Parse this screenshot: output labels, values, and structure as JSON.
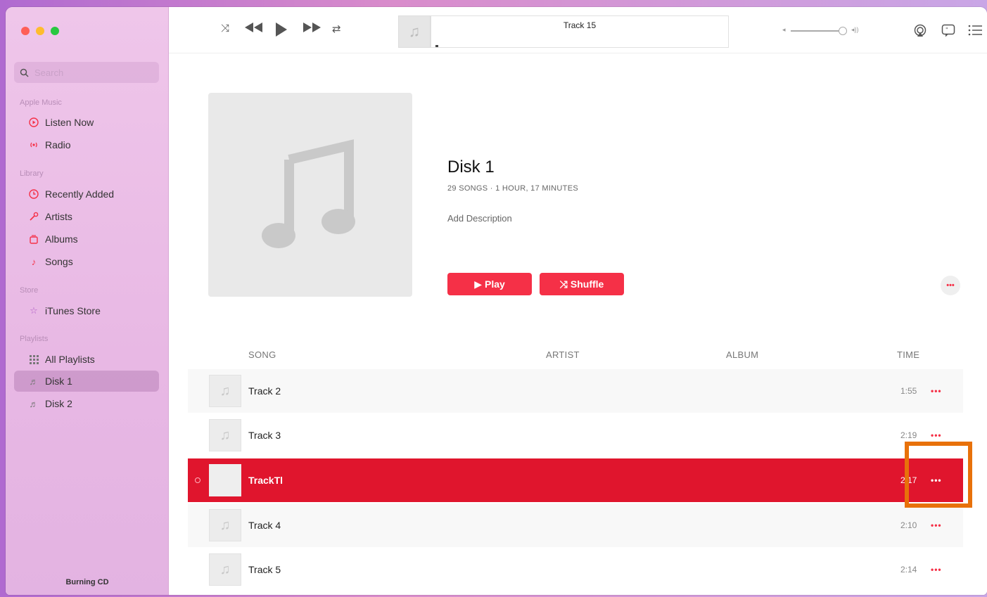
{
  "window": {
    "traffic_colors": [
      "#fe5f57",
      "#febc2e",
      "#28c840"
    ]
  },
  "sidebar": {
    "search_placeholder": "Search",
    "sections": {
      "apple_music": "Apple Music",
      "library": "Library",
      "store": "Store",
      "playlists": "Playlists"
    },
    "items": {
      "listen_now": "Listen Now",
      "radio": "Radio",
      "recently_added": "Recently Added",
      "artists": "Artists",
      "albums": "Albums",
      "songs": "Songs",
      "itunes_store": "iTunes Store",
      "all_playlists": "All Playlists",
      "disk1": "Disk 1",
      "disk2": "Disk 2"
    },
    "status": "Burning CD"
  },
  "toolbar": {
    "now_playing": "Track 15",
    "icons": [
      "shuffle-icon",
      "previous-icon",
      "play-icon",
      "next-icon",
      "repeat-icon",
      "airplay-icon",
      "lyrics-icon",
      "queue-icon"
    ]
  },
  "album": {
    "title": "Disk 1",
    "meta": "29 SONGS · 1 HOUR, 17 MINUTES",
    "description": "Add Description",
    "play_label": "Play",
    "shuffle_label": "Shuffle",
    "more_label": "•••"
  },
  "columns": {
    "song": "SONG",
    "artist": "ARTIST",
    "album": "ALBUM",
    "time": "TIME"
  },
  "tracks": [
    {
      "title": "Track 2",
      "time": "1:55",
      "more": "•••"
    },
    {
      "title": "Track 3",
      "time": "2:19",
      "more": "•••"
    },
    {
      "title": "TrackTl",
      "time": "2:17",
      "more": "•••"
    },
    {
      "title": "Track 4",
      "time": "2:10",
      "more": "•••"
    },
    {
      "title": "Track 5",
      "time": "2:14",
      "more": "•••"
    }
  ],
  "colors": {
    "accent": "#f53047",
    "selected_row": "#e0152d",
    "highlight_box": "#e8710a"
  }
}
